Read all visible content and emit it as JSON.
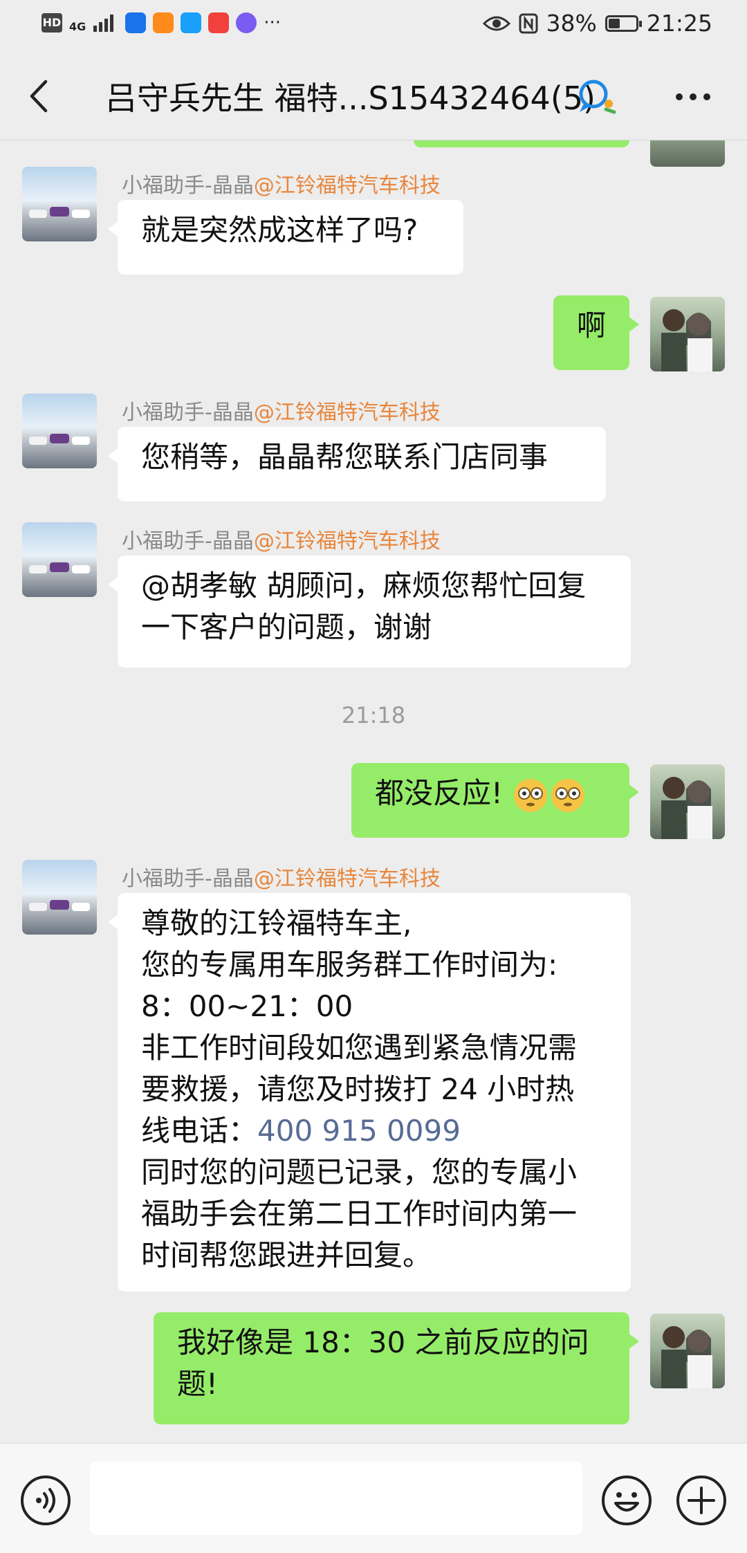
{
  "status_bar": {
    "hd": "HD",
    "network": "4G",
    "battery_percent": "38%",
    "battery_level": 0.38,
    "time": "21:25",
    "more": "···"
  },
  "header": {
    "title": "吕守兵先生 福特...S15432464(5)"
  },
  "messages": {
    "m1": {
      "sender_name": "小福助手-晶晶",
      "sender_org": "@江铃福特汽车科技",
      "text": "就是突然成这样了吗?"
    },
    "m2": {
      "text": "啊"
    },
    "m3": {
      "sender_name": "小福助手-晶晶",
      "sender_org": "@江铃福特汽车科技",
      "text": "您稍等，晶晶帮您联系门店同事"
    },
    "m4": {
      "sender_name": "小福助手-晶晶",
      "sender_org": "@江铃福特汽车科技",
      "line1": "@胡孝敏 胡顾问，麻烦您帮忙回复",
      "line2": "一下客户的问题，谢谢"
    },
    "time1": "21:18",
    "m5": {
      "text": "都没反应!"
    },
    "m6": {
      "sender_name": "小福助手-晶晶",
      "sender_org": "@江铃福特汽车科技",
      "line1": "尊敬的江铃福特车主,",
      "line2": "您的专属用车服务群工作时间为:",
      "line3": "8：00~21：00",
      "line4": "非工作时间段如您遇到紧急情况需",
      "line5": "要救援，请您及时拨打 24 小时热",
      "line6_prefix": "线电话：",
      "phone": "400 915 0099",
      "line7": "同时您的问题已记录，您的专属小",
      "line8": "福助手会在第二日工作时间内第一",
      "line9": "时间帮您跟进并回复。"
    },
    "m7": {
      "line1": "我好像是 18：30 之前反应的问",
      "line2": "题!"
    }
  },
  "colors": {
    "background": "#ededed",
    "bubble_self": "#95ec69",
    "bubble_other": "#ffffff",
    "sender_org": "#e9863c",
    "link": "#576b95"
  }
}
